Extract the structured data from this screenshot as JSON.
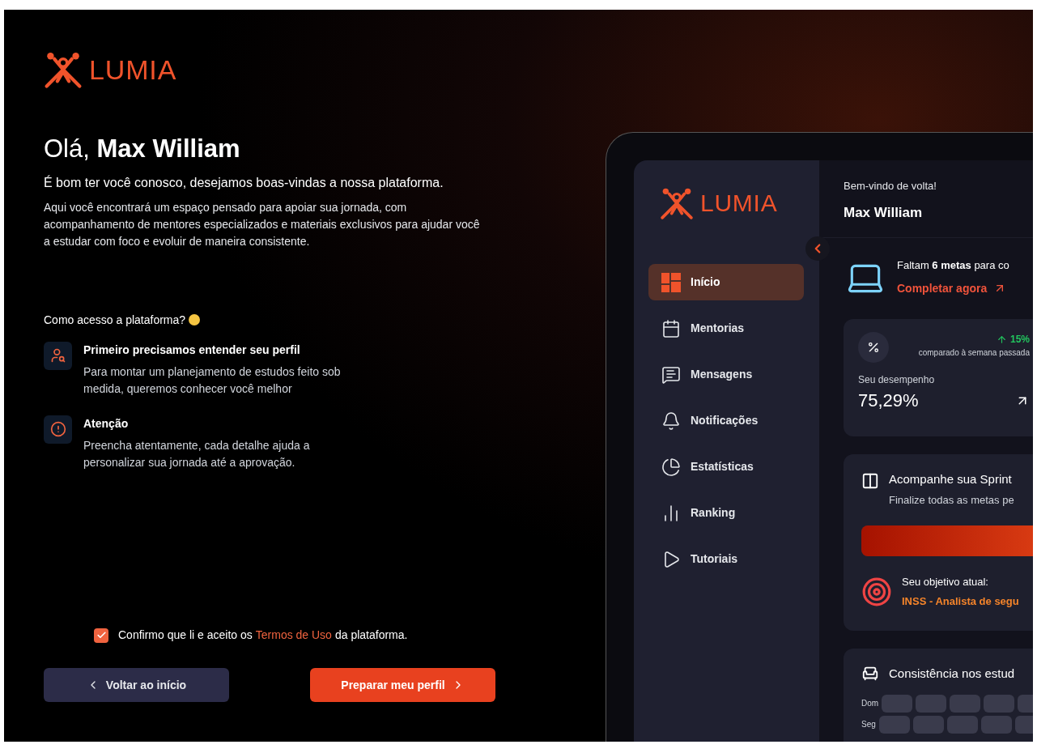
{
  "brand": {
    "name": "LUMIA"
  },
  "greeting": {
    "text": "Olá, **Max William**"
  },
  "subtitle": "É bom ter você conosco, desejamos boas-vindas a nossa plataforma.",
  "intro": "Aqui você encontrará um espaço pensado para apoiar sua jornada, com acompanhamento de mentores especializados e materiais exclusivos para ajudar você a estudar com foco e evoluir de maneira consistente.",
  "question": "Como acesso a plataforma?",
  "steps": [
    {
      "kind": "profile",
      "title": "Primeiro precisamos entender seu perfil",
      "text": "Para montar um planejamento de estudos feito sob medida, queremos conhecer você melhor"
    },
    {
      "kind": "alert",
      "title": "Atenção",
      "text": "Preencha atentamente, cada detalhe ajuda a personalizar sua jornada até a aprovação."
    }
  ],
  "terms": {
    "checked": true,
    "before": "Confirmo que li e aceito os",
    "link": "Termos de Uso",
    "after": "da plataforma."
  },
  "buttons": {
    "back": "Voltar ao início",
    "next": "Preparar meu perfil"
  },
  "preview": {
    "brand": "LUMIA",
    "nav": [
      {
        "kind": "home",
        "label": "Início",
        "selected": true
      },
      {
        "kind": "calendar",
        "label": "Mentorias",
        "selected": false
      },
      {
        "kind": "messages",
        "label": "Mensagens",
        "selected": false
      },
      {
        "kind": "bell",
        "label": "Notificações",
        "selected": false
      },
      {
        "kind": "pie",
        "label": "Estatísticas",
        "selected": false
      },
      {
        "kind": "bars",
        "label": "Ranking",
        "selected": false
      },
      {
        "kind": "play",
        "label": "Tutoriais",
        "selected": false
      }
    ],
    "welcome": "Bem-vindo de volta!",
    "user": "Max William",
    "goals": {
      "text": "Faltam **6 metas** para co",
      "link": "Completar agora"
    },
    "performance": {
      "change": "15%",
      "compare": "comparado à semana passada",
      "label": "Seu desempenho",
      "value": "75,29%"
    },
    "sprint": {
      "title": "Acompanhe sua Sprint",
      "text": "Finalize todas as metas pe",
      "level": 1,
      "objective_label": "Seu objetivo atual:",
      "objective": "INSS - Analista de segu"
    },
    "consistency": {
      "title": "Consistência nos estud",
      "days": [
        "Dom",
        "Seg"
      ]
    }
  }
}
